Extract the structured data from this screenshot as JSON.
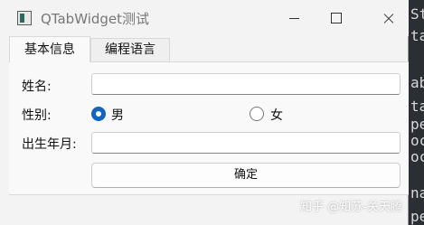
{
  "window": {
    "title": "QTabWidget测试"
  },
  "tabs": [
    {
      "label": "基本信息",
      "active": true
    },
    {
      "label": "编程语言",
      "active": false
    }
  ],
  "form": {
    "name_label": "姓名:",
    "name_value": "",
    "gender_label": "性别:",
    "gender_options": [
      {
        "label": "男",
        "checked": true
      },
      {
        "label": "女",
        "checked": false
      }
    ],
    "birth_label": "出生年月:",
    "birth_value": "",
    "confirm_label": "确定"
  },
  "watermark": "知乎 @知苏-关天腾",
  "background_fragments": [
    "Sta",
    "ta",
    "ab",
    "ta",
    "pe",
    "oc",
    "oc",
    "na",
    "pe"
  ],
  "colors": {
    "accent": "#1165c0",
    "window_bg": "#f3f3f3",
    "panel_bg": "#f9f9f9"
  }
}
